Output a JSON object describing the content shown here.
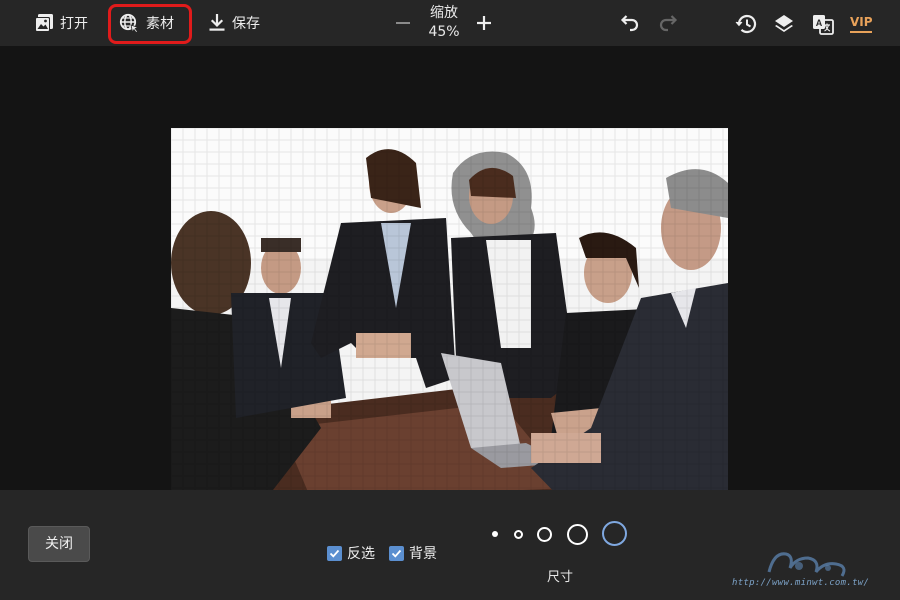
{
  "toolbar": {
    "open_label": "打开",
    "assets_label": "素材",
    "save_label": "保存",
    "zoom_title": "缩放",
    "zoom_value": "45%",
    "vip_label": "VIP"
  },
  "bottom": {
    "close_label": "关闭",
    "invert_label": "反选",
    "background_label": "背景",
    "size_label": "尺寸",
    "invert_checked": true,
    "background_checked": true
  },
  "icons": {
    "open": "image-icon",
    "assets": "globe-icon",
    "save": "download-icon",
    "undo": "undo-icon",
    "redo": "redo-icon",
    "history": "history-icon",
    "layers": "layers-icon",
    "translate": "translate-icon"
  },
  "colors": {
    "highlight": "#e01b1b",
    "accent": "#5b8fd0",
    "vip": "#e8a25a"
  },
  "watermark": {
    "url_text": "http://www.minwt.com.tw/"
  }
}
